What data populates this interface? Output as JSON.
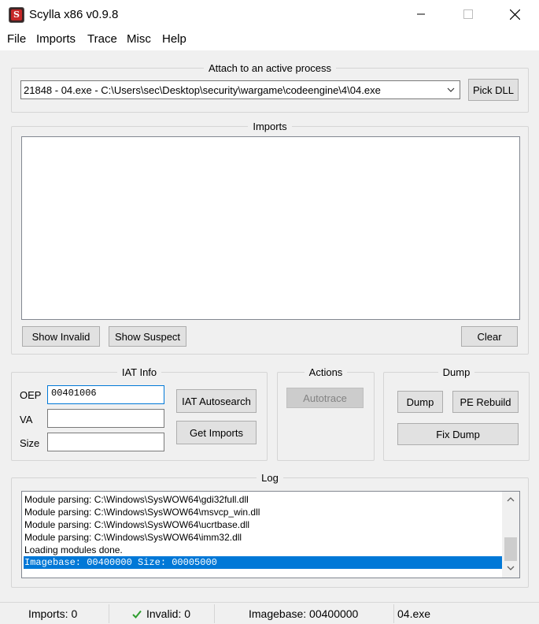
{
  "window": {
    "title": "Scylla x86 v0.9.8"
  },
  "menu": {
    "file": "File",
    "imports": "Imports",
    "trace": "Trace",
    "misc": "Misc",
    "help": "Help"
  },
  "attach": {
    "label": "Attach to an active process",
    "selected_process": "21848 - 04.exe - C:\\Users\\sec\\Desktop\\security\\wargame\\codeengine\\4\\04.exe",
    "pick_dll": "Pick DLL"
  },
  "imports": {
    "label": "Imports",
    "show_invalid": "Show Invalid",
    "show_suspect": "Show Suspect",
    "clear": "Clear"
  },
  "iat": {
    "label": "IAT Info",
    "oep_label": "OEP",
    "oep_value": "00401006",
    "va_label": "VA",
    "va_value": "",
    "size_label": "Size",
    "size_value": "",
    "autosearch": "IAT Autosearch",
    "get_imports": "Get Imports"
  },
  "actions": {
    "label": "Actions",
    "autotrace": "Autotrace"
  },
  "dump": {
    "label": "Dump",
    "dump": "Dump",
    "pe_rebuild": "PE Rebuild",
    "fix_dump": "Fix Dump"
  },
  "log": {
    "label": "Log",
    "lines": [
      "Module parsing: C:\\Windows\\SysWOW64\\gdi32full.dll",
      "Module parsing: C:\\Windows\\SysWOW64\\msvcp_win.dll",
      "Module parsing: C:\\Windows\\SysWOW64\\ucrtbase.dll",
      "Module parsing: C:\\Windows\\SysWOW64\\imm32.dll",
      "Loading modules done.",
      "Imagebase: 00400000 Size: 00005000"
    ]
  },
  "status": {
    "imports": "Imports: 0",
    "invalid": "Invalid: 0",
    "imagebase": "Imagebase: 00400000",
    "module": "04.exe"
  },
  "colors": {
    "accent": "#0078d7",
    "valid_check": "#2e9d2e"
  }
}
